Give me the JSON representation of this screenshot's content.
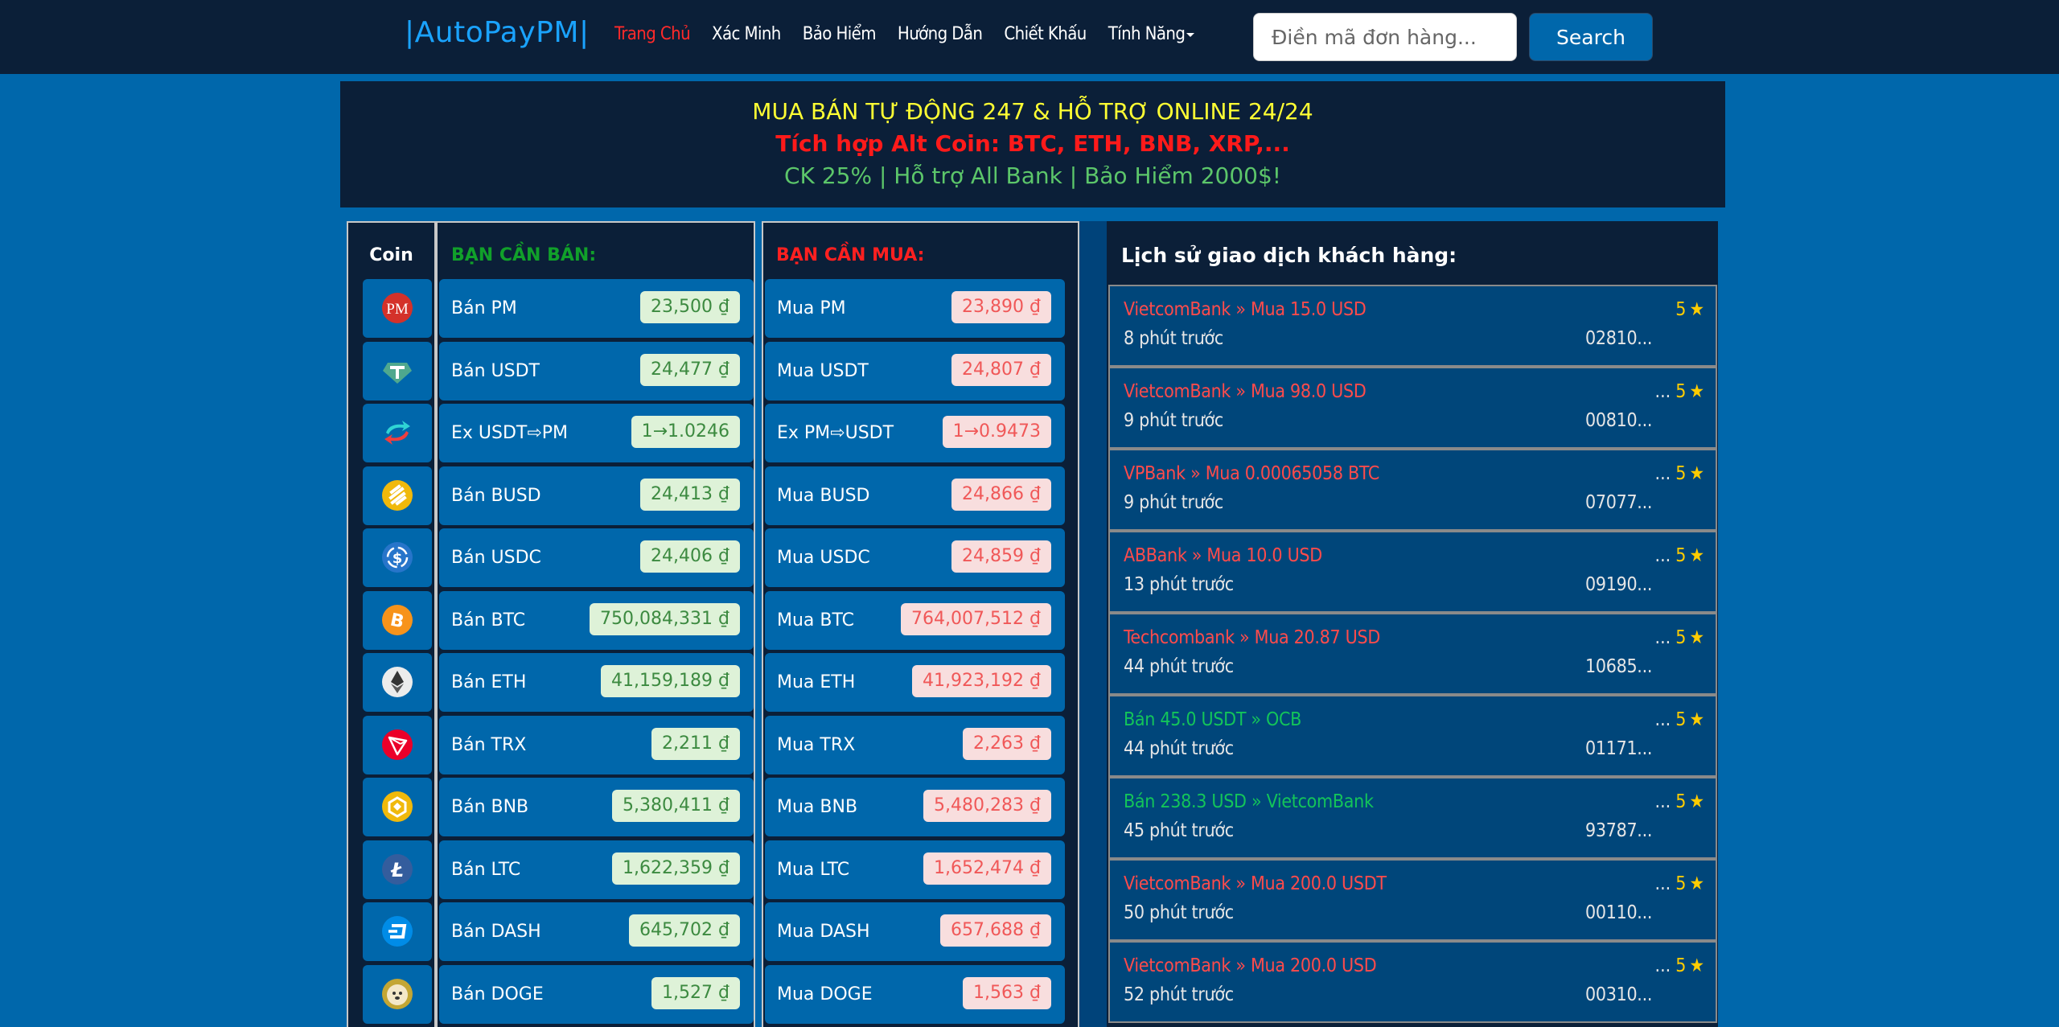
{
  "nav": {
    "brand": "|AutoPayPM|",
    "links": [
      {
        "label": "Trang Chủ",
        "active": true
      },
      {
        "label": "Xác Minh",
        "active": false
      },
      {
        "label": "Bảo Hiểm",
        "active": false
      },
      {
        "label": "Hướng Dẫn",
        "active": false
      },
      {
        "label": "Chiết Khấu",
        "active": false
      },
      {
        "label": "Tính Năng",
        "active": false,
        "dropdown": true
      }
    ],
    "search_placeholder": "Điền mã đơn hàng...",
    "search_value": "",
    "search_button": "Search"
  },
  "banner": {
    "line1": "MUA BÁN TỰ ĐỘNG 247 & HỖ TRỢ ONLINE 24/24",
    "line2": "Tích hợp Alt Coin: BTC, ETH, BNB, XRP,...",
    "line3": "CK 25% | Hỗ trợ All Bank | Bảo Hiểm 2000$!"
  },
  "rates": {
    "coin_header": "Coin",
    "sell_header": "BẠN CẦN BÁN:",
    "buy_header": "BẠN CẦN MUA:",
    "rows": [
      {
        "coin": "PM",
        "icon": "perfect-money-icon",
        "sell_label": "Bán PM",
        "sell_price": "23,500 ₫",
        "buy_label": "Mua PM",
        "buy_price": "23,890 ₫"
      },
      {
        "coin": "USDT",
        "icon": "tether-icon",
        "sell_label": "Bán USDT",
        "sell_price": "24,477 ₫",
        "buy_label": "Mua USDT",
        "buy_price": "24,807 ₫"
      },
      {
        "coin": "EX",
        "icon": "exchange-arrows-icon",
        "sell_label": "Ex USDT⇨PM",
        "sell_price": "1→1.0246",
        "buy_label": "Ex PM⇨USDT",
        "buy_price": "1→0.9473"
      },
      {
        "coin": "BUSD",
        "icon": "busd-icon",
        "sell_label": "Bán BUSD",
        "sell_price": "24,413 ₫",
        "buy_label": "Mua BUSD",
        "buy_price": "24,866 ₫"
      },
      {
        "coin": "USDC",
        "icon": "usdc-icon",
        "sell_label": "Bán USDC",
        "sell_price": "24,406 ₫",
        "buy_label": "Mua USDC",
        "buy_price": "24,859 ₫"
      },
      {
        "coin": "BTC",
        "icon": "bitcoin-icon",
        "sell_label": "Bán BTC",
        "sell_price": "750,084,331 ₫",
        "buy_label": "Mua BTC",
        "buy_price": "764,007,512 ₫"
      },
      {
        "coin": "ETH",
        "icon": "ethereum-icon",
        "sell_label": "Bán ETH",
        "sell_price": "41,159,189 ₫",
        "buy_label": "Mua ETH",
        "buy_price": "41,923,192 ₫"
      },
      {
        "coin": "TRX",
        "icon": "tron-icon",
        "sell_label": "Bán TRX",
        "sell_price": "2,211 ₫",
        "buy_label": "Mua TRX",
        "buy_price": "2,263 ₫"
      },
      {
        "coin": "BNB",
        "icon": "bnb-icon",
        "sell_label": "Bán BNB",
        "sell_price": "5,380,411 ₫",
        "buy_label": "Mua BNB",
        "buy_price": "5,480,283 ₫"
      },
      {
        "coin": "LTC",
        "icon": "litecoin-icon",
        "sell_label": "Bán LTC",
        "sell_price": "1,622,359 ₫",
        "buy_label": "Mua LTC",
        "buy_price": "1,652,474 ₫"
      },
      {
        "coin": "DASH",
        "icon": "dash-icon",
        "sell_label": "Bán DASH",
        "sell_price": "645,702 ₫",
        "buy_label": "Mua DASH",
        "buy_price": "657,688 ₫"
      },
      {
        "coin": "DOGE",
        "icon": "dogecoin-icon",
        "sell_label": "Bán DOGE",
        "sell_price": "1,527 ₫",
        "buy_label": "Mua DOGE",
        "buy_price": "1,563 ₫"
      }
    ]
  },
  "history": {
    "title": "Lịch sử giao dịch khách hàng:",
    "items": [
      {
        "text": "VietcomBank » Mua 15.0 USD",
        "type": "buy",
        "time": "8 phút trước",
        "code": "02810...",
        "prefix": "",
        "rating": "5"
      },
      {
        "text": "VietcomBank » Mua 98.0 USD",
        "type": "buy",
        "time": "9 phút trước",
        "code": "00810...",
        "prefix": "...",
        "rating": "5"
      },
      {
        "text": "VPBank » Mua 0.00065058 BTC",
        "type": "buy",
        "time": "9 phút trước",
        "code": "07077...",
        "prefix": "...",
        "rating": "5"
      },
      {
        "text": "ABBank » Mua 10.0 USD",
        "type": "buy",
        "time": "13 phút trước",
        "code": "09190...",
        "prefix": "...",
        "rating": "5"
      },
      {
        "text": "Techcombank » Mua 20.87 USD",
        "type": "buy",
        "time": "44 phút trước",
        "code": "10685...",
        "prefix": "...",
        "rating": "5"
      },
      {
        "text": "Bán 45.0 USDT » OCB",
        "type": "sell",
        "time": "44 phút trước",
        "code": "01171...",
        "prefix": "...",
        "rating": "5"
      },
      {
        "text": "Bán 238.3 USD » VietcomBank",
        "type": "sell",
        "time": "45 phút trước",
        "code": "93787...",
        "prefix": "...",
        "rating": "5"
      },
      {
        "text": "VietcomBank » Mua 200.0 USDT",
        "type": "buy",
        "time": "50 phút trước",
        "code": "00110...",
        "prefix": "...",
        "rating": "5"
      },
      {
        "text": "VietcomBank » Mua 200.0 USD",
        "type": "buy",
        "time": "52 phút trước",
        "code": "00310...",
        "prefix": "...",
        "rating": "5"
      }
    ]
  },
  "colors": {
    "page_bg": "#0067ab",
    "panel_bg": "#0b1f38",
    "brand": "#1aa3ff",
    "active_nav": "#ff2a2a",
    "sell_header": "#11a02a",
    "buy_header": "#ff2020",
    "sell_price_bg": "#def2d8",
    "buy_price_bg": "#f8dede",
    "star": "#ffcc00"
  }
}
